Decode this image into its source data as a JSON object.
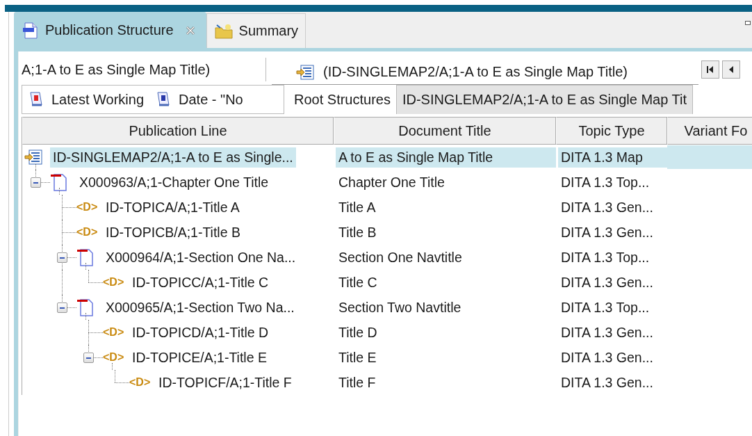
{
  "tabs": [
    {
      "label": "Publication Structure",
      "kind": "xml",
      "selected": true,
      "closable": true
    },
    {
      "label": "Summary",
      "kind": "folder",
      "selected": false,
      "closable": false
    }
  ],
  "breadcrumb": "A;1-A to E as Single Map Title)",
  "current_map": "(ID-SINGLEMAP2/A;1-A to E as Single Map Title)",
  "filters": [
    {
      "label": "Latest Working",
      "kind": "r"
    },
    {
      "label": "Date - \"No",
      "kind": "e"
    }
  ],
  "structure_tabs": [
    {
      "label": "Root Structures",
      "selected": true
    },
    {
      "label": "ID-SINGLEMAP2/A;1-A to E as Single Map Tit",
      "selected": false
    }
  ],
  "table": {
    "columns": [
      "Publication Line",
      "Document Title",
      "Topic Type",
      "Variant Fo"
    ],
    "rows": [
      {
        "publication_line": "ID-SINGLEMAP2/A;1-A to E as Single...",
        "document_title": "A to E as Single Map Title",
        "topic_type": "DITA 1.3 Map",
        "kind": "map",
        "selected": true,
        "children": [
          {
            "publication_line": "X000963/A;1-Chapter One Title",
            "document_title": "Chapter One Title",
            "topic_type": "DITA 1.3 Top...",
            "kind": "chapter",
            "selected": false,
            "expanded": true,
            "children": [
              {
                "publication_line": "ID-TOPICA/A;1-Title A",
                "document_title": "Title A",
                "topic_type": "DITA 1.3 Gen...",
                "kind": "topic",
                "badge": "<D>",
                "selected": false
              },
              {
                "publication_line": "ID-TOPICB/A;1-Title B",
                "document_title": "Title B",
                "topic_type": "DITA 1.3 Gen...",
                "kind": "topic",
                "badge": "<D>",
                "selected": false
              },
              {
                "publication_line": "X000964/A;1-Section One Na...",
                "document_title": "Section One Navtitle",
                "topic_type": "DITA 1.3 Top...",
                "kind": "chapter",
                "selected": false,
                "expanded": true,
                "children": [
                  {
                    "publication_line": "ID-TOPICC/A;1-Title C",
                    "document_title": "Title C",
                    "topic_type": "DITA 1.3 Gen...",
                    "kind": "topic",
                    "badge": "<D>",
                    "selected": false
                  }
                ]
              },
              {
                "publication_line": "X000965/A;1-Section Two Na...",
                "document_title": "Section Two Navtitle",
                "topic_type": "DITA 1.3 Top...",
                "kind": "chapter",
                "selected": false,
                "expanded": true,
                "children": [
                  {
                    "publication_line": "ID-TOPICD/A;1-Title D",
                    "document_title": "Title D",
                    "topic_type": "DITA 1.3 Gen...",
                    "kind": "topic",
                    "badge": "<D>",
                    "selected": false
                  },
                  {
                    "publication_line": "ID-TOPICE/A;1-Title E",
                    "document_title": "Title E",
                    "topic_type": "DITA 1.3 Gen...",
                    "kind": "topic",
                    "badge": "<D>",
                    "selected": false,
                    "expanded": true,
                    "children": [
                      {
                        "publication_line": "ID-TOPICF/A;1-Title F",
                        "document_title": "Title F",
                        "topic_type": "DITA 1.3 Gen...",
                        "kind": "topic",
                        "badge": "<D>",
                        "selected": false
                      }
                    ]
                  }
                ]
              }
            ]
          }
        ]
      }
    ]
  }
}
